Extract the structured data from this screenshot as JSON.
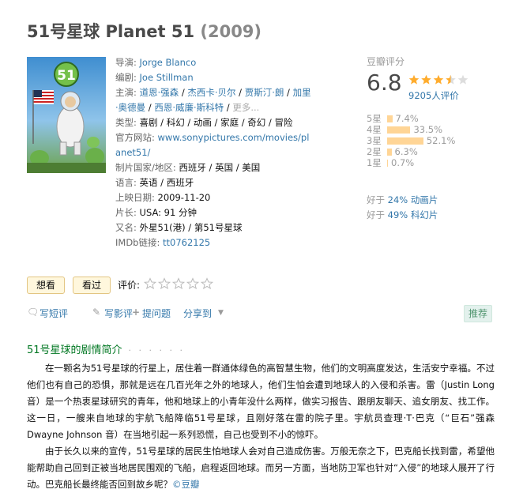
{
  "movie": {
    "title": "51号星球 Planet 51",
    "year": "(2009)"
  },
  "info": {
    "director_label": "导演:",
    "director": "Jorge Blanco",
    "writer_label": "编剧:",
    "writer": "Joe Stillman",
    "cast_label": "主演:",
    "cast": [
      "道恩·强森",
      "杰西卡·贝尔",
      "贾斯汀·朗",
      "加里·奥德曼",
      "西恩·威廉·斯科特"
    ],
    "cast_more": "更多...",
    "genre_label": "类型:",
    "genres": "喜剧 / 科幻 / 动画 / 家庭 / 奇幻 / 冒险",
    "site_label": "官方网站:",
    "site": "www.sonypictures.com/movies/planet51/",
    "country_label": "制片国家/地区:",
    "country": "西班牙 / 英国 / 美国",
    "lang_label": "语言:",
    "lang": "英语 / 西班牙",
    "release_label": "上映日期:",
    "release": "2009-11-20",
    "runtime_label": "片长:",
    "runtime": "USA: 91 分钟",
    "aka_label": "又名:",
    "aka": "外星51(港) / 第51号星球",
    "imdb_label": "IMDb链接:",
    "imdb": "tt0762125"
  },
  "rating": {
    "label": "豆瓣评分",
    "score": "6.8",
    "stars": 3.5,
    "count": "9205人评价",
    "distribution": [
      {
        "label": "5星",
        "pct": "7.4%",
        "value": 7.4
      },
      {
        "label": "4星",
        "pct": "33.5%",
        "value": 33.5
      },
      {
        "label": "3星",
        "pct": "52.1%",
        "value": 52.1
      },
      {
        "label": "2星",
        "pct": "6.3%",
        "value": 6.3
      },
      {
        "label": "1星",
        "pct": "0.7%",
        "value": 0.7
      }
    ],
    "better_than": [
      {
        "prefix": "好于 ",
        "text": "24% 动画片"
      },
      {
        "prefix": "好于 ",
        "text": "49% 科幻片"
      }
    ],
    "star_color": "#ffac2d"
  },
  "actions": {
    "want": "想看",
    "seen": "看过",
    "rate_label": "评价:"
  },
  "links": {
    "short_review": "写短评",
    "review": "写影评",
    "question": "提问题",
    "share": "分享到",
    "recommend": "推荐"
  },
  "synopsis": {
    "title": "51号星球的剧情简介",
    "dots": "· · · · · ·",
    "p1": "在一颗名为51号星球的行星上，居住着一群通体绿色的高智慧生物，他们的文明高度发达，生活安宁幸福。不过他们也有自己的恐惧，那就是远在几百光年之外的地球人，他们生怕会遭到地球人的入侵和杀害。雷（Justin Long 音）是一个热衷星球研究的青年，他和地球上的小青年没什么两样，做实习报告、跟朋友聊天、追女朋友、找工作。这一日，一艘来自地球的宇航飞船降临51号星球，且刚好落在雷的院子里。宇航员查理·T·巴克（“巨石”强森 Dwayne Johnson 音）在当地引起一系列恐慌，自己也受到不小的惊吓。",
    "p2": "由于长久以来的宣传，51号星球的居民生怕地球人会对自己造成伤害。万般无奈之下，巴克船长找到雷，希望他能帮助自己回到正被当地居民围观的飞船，启程返回地球。而另一方面，当地防卫军也针对“入侵”的地球人展开了行动。巴克船长最终能否回到故乡呢？",
    "source": "©豆瓣"
  }
}
